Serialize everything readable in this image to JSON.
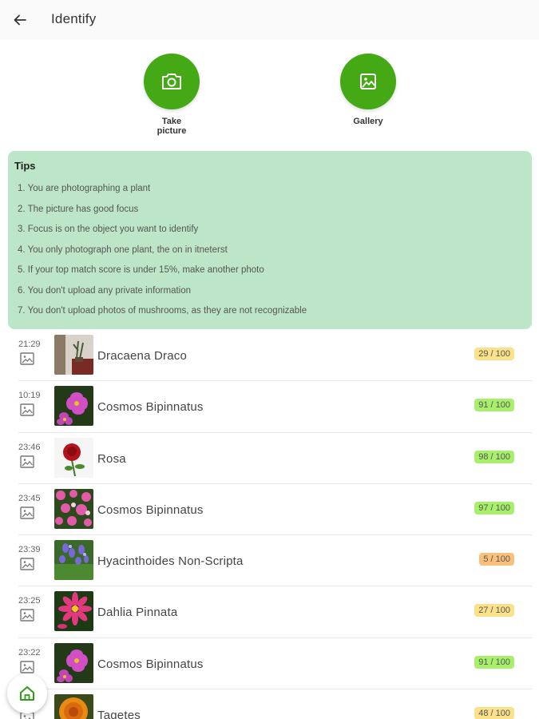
{
  "header": {
    "title": "Identify"
  },
  "actions": {
    "take_picture": "Take picture",
    "gallery": "Gallery"
  },
  "tips": {
    "title": "Tips",
    "items": [
      "1. You are photographing a plant",
      "2. The picture has good focus",
      "3. Focus is on the object you want to identify",
      "4. You only photograph one plant, the on in itneterst",
      "5. If your top match score is under 15%, make another photo",
      "6. You don't upload any private information",
      "7. You don't upload photos of mushrooms, as they are not recognizable"
    ]
  },
  "history": [
    {
      "time": "21:29",
      "name": "Dracaena Draco",
      "score": "29 / 100",
      "score_color": "#fbe28a",
      "thumb": "room"
    },
    {
      "time": "10:19",
      "name": "Cosmos Bipinnatus",
      "score": "91 / 100",
      "score_color": "#a8f06c",
      "thumb": "pink-flower"
    },
    {
      "time": "23:46",
      "name": "Rosa",
      "score": "98 / 100",
      "score_color": "#a8f06c",
      "thumb": "rose"
    },
    {
      "time": "23:45",
      "name": "Cosmos Bipinnatus",
      "score": "97 / 100",
      "score_color": "#a8f06c",
      "thumb": "pink-field"
    },
    {
      "time": "23:39",
      "name": "Hyacinthoides Non-Scripta",
      "score": "5 / 100",
      "score_color": "#f8c07a",
      "thumb": "bluebell"
    },
    {
      "time": "23:25",
      "name": "Dahlia Pinnata",
      "score": "27 / 100",
      "score_color": "#fbe28a",
      "thumb": "dahlia"
    },
    {
      "time": "23:22",
      "name": "Cosmos Bipinnatus",
      "score": "91 / 100",
      "score_color": "#a8f06c",
      "thumb": "pink-flower"
    },
    {
      "time": "",
      "name": "Tagetes",
      "score": "48 / 100",
      "score_color": "#fbe28a",
      "thumb": "marigold"
    }
  ],
  "colors": {
    "accent": "#45a916",
    "tips_bg": "#bde6c8"
  },
  "icons": {
    "back": "arrow-left-icon",
    "camera": "camera-icon",
    "gallery": "image-icon",
    "home": "home-icon"
  }
}
